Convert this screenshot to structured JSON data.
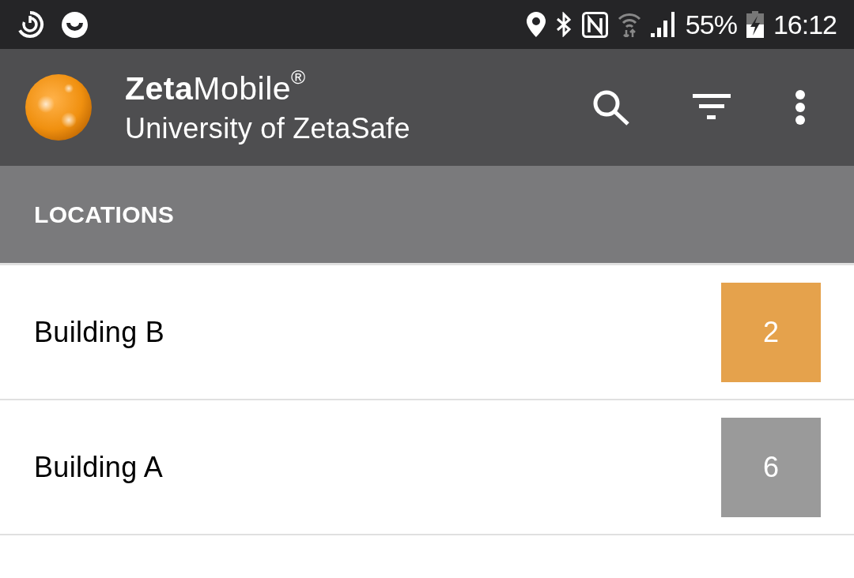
{
  "status_bar": {
    "battery": "55%",
    "time": "16:12"
  },
  "app_bar": {
    "title": "**Zeta**Mobile$^{®}$",
    "subtitle": "University of ZetaSafe"
  },
  "section_header": "LOCATIONS",
  "locations": [
    {
      "name": "Building B",
      "count": "2",
      "color": "#e5a24c"
    },
    {
      "name": "Building A",
      "count": "6",
      "color": "#9a9a9a"
    }
  ]
}
